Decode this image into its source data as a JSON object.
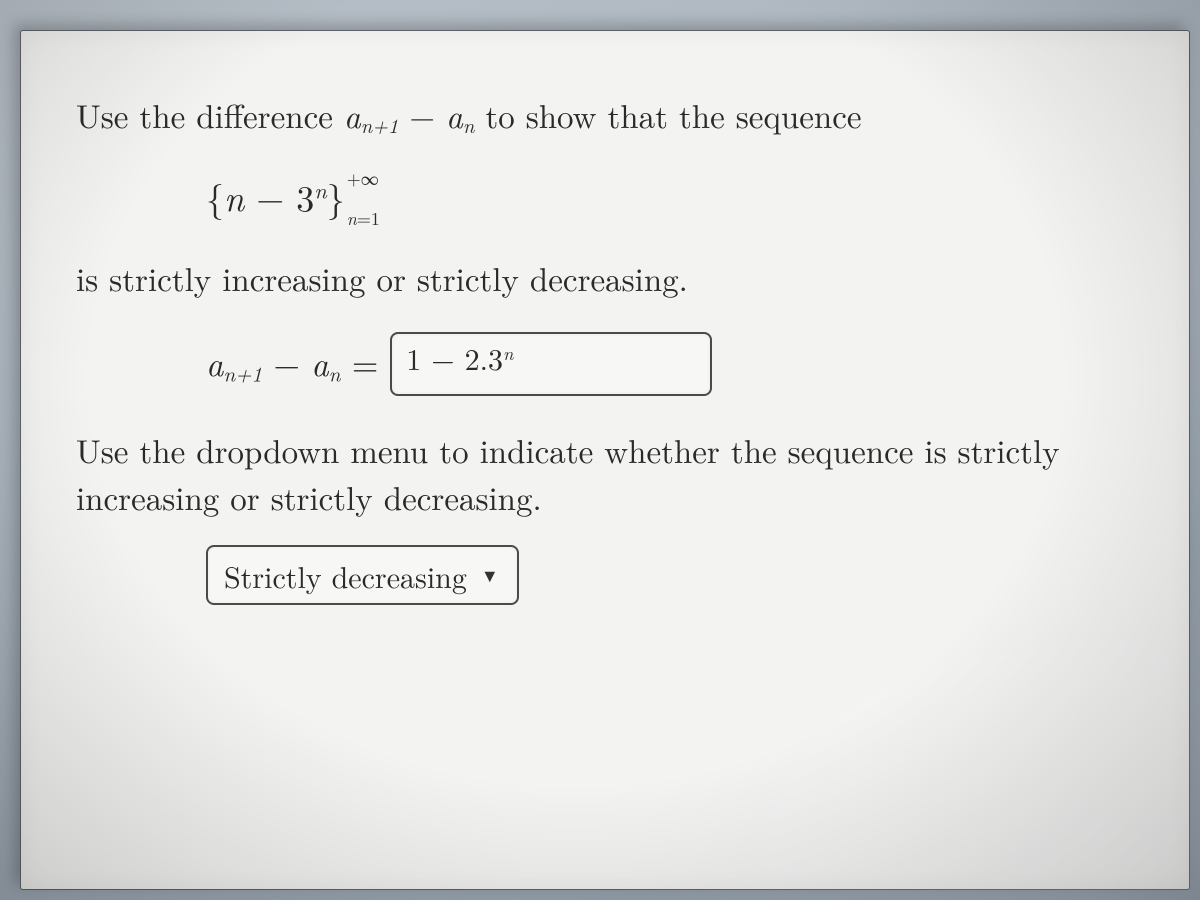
{
  "problem": {
    "line1_pre": "Use the difference ",
    "line1_post": " to show that the sequence",
    "difference_expr": {
      "a": "a",
      "sub_np1": "n+1",
      "minus": " − ",
      "sub_n": "n"
    },
    "sequence": {
      "open": "{",
      "var": "n",
      "minus": " − ",
      "base": "3",
      "exp": "n",
      "close": "}",
      "sup": "+∞",
      "sub_lhs": "n",
      "sub_eq": "=",
      "sub_rhs": "1"
    },
    "line2": "is strictly increasing or strictly decreasing.",
    "answer_row": {
      "a": "a",
      "sub_np1": "n+1",
      "minus": " − ",
      "sub_n": "n",
      "equals": " = "
    },
    "answer_value_plain": "1 − 2.3",
    "answer_value_exp": "n",
    "line3": "Use the dropdown menu to indicate whether the sequence is strictly increasing or strictly decreasing.",
    "dropdown_value": "Strictly decreasing"
  }
}
